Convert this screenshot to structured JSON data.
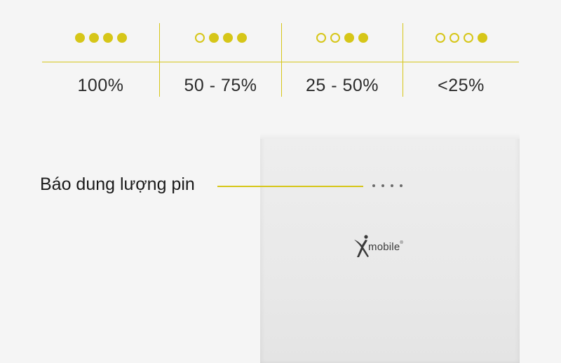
{
  "legend": {
    "levels": [
      {
        "label": "100%",
        "filled": 4
      },
      {
        "label": "50 - 75%",
        "filled": 3
      },
      {
        "label": "25 - 50%",
        "filled": 2
      },
      {
        "label": "<25%",
        "filled": 1
      }
    ],
    "accent_color": "#d6c618"
  },
  "callout": {
    "label": "Báo dung lượng pin"
  },
  "device": {
    "brand": "mobile",
    "brand_mark": "®",
    "indicator_count": 4
  }
}
